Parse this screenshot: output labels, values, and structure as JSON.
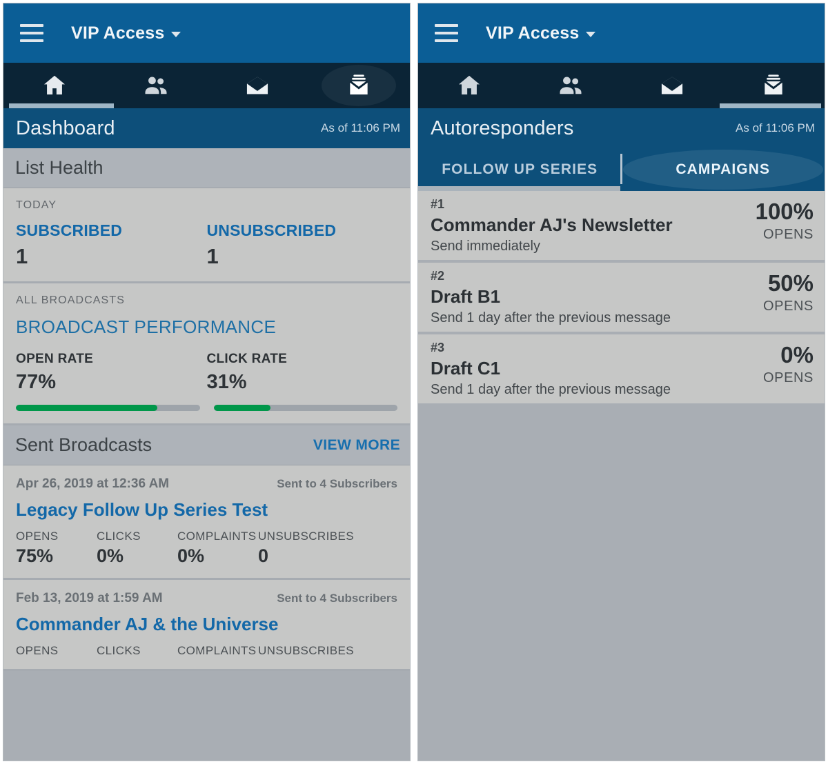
{
  "colors": {
    "appbar": "#0b5e96",
    "navbar": "#0b2436",
    "title_band": "#0d4f7a",
    "accent_blue": "#1368a8",
    "progress_green": "#00974a",
    "panel_gray": "#c6c7c6",
    "page_gray": "#a9aeb4"
  },
  "left_panel": {
    "appbar": {
      "menu_icon": "hamburger-icon",
      "brand": "VIP Access",
      "dropdown_icon": "caret-down-icon"
    },
    "nav": {
      "items": [
        {
          "icon": "home-icon",
          "name": "home"
        },
        {
          "icon": "people-icon",
          "name": "subscribers"
        },
        {
          "icon": "mail-open-icon",
          "name": "broadcasts"
        },
        {
          "icon": "drafts-stack-icon",
          "name": "autoresponders"
        }
      ],
      "active_index": 0
    },
    "title": "Dashboard",
    "as_of": "As of 11:06 PM",
    "list_health": {
      "section_title": "List Health",
      "kicker": "TODAY",
      "stats": [
        {
          "label": "SUBSCRIBED",
          "value": "1"
        },
        {
          "label": "UNSUBSCRIBED",
          "value": "1"
        }
      ]
    },
    "broadcast_performance": {
      "kicker": "ALL BROADCASTS",
      "heading": "BROADCAST PERFORMANCE",
      "stats": [
        {
          "label": "OPEN RATE",
          "value": "77%",
          "percent": 77
        },
        {
          "label": "CLICK RATE",
          "value": "31%",
          "percent": 31
        }
      ]
    },
    "sent_broadcasts": {
      "section_title": "Sent Broadcasts",
      "view_more": "VIEW MORE",
      "items": [
        {
          "date": "Apr 26, 2019 at 12:36 AM",
          "sent_to": "Sent to 4 Subscribers",
          "title": "Legacy Follow Up Series Test",
          "stats": [
            {
              "label": "OPENS",
              "value": "75%"
            },
            {
              "label": "CLICKS",
              "value": "0%"
            },
            {
              "label": "COMPLAINTS",
              "value": "0%"
            },
            {
              "label": "UNSUBSCRIBES",
              "value": "0"
            }
          ]
        },
        {
          "date": "Feb 13, 2019 at 1:59 AM",
          "sent_to": "Sent to 4 Subscribers",
          "title": "Commander AJ & the Universe",
          "stats": [
            {
              "label": "OPENS",
              "value": ""
            },
            {
              "label": "CLICKS",
              "value": ""
            },
            {
              "label": "COMPLAINTS",
              "value": ""
            },
            {
              "label": "UNSUBSCRIBES",
              "value": ""
            }
          ]
        }
      ]
    }
  },
  "right_panel": {
    "appbar": {
      "menu_icon": "hamburger-icon",
      "brand": "VIP Access",
      "dropdown_icon": "caret-down-icon"
    },
    "nav": {
      "items": [
        {
          "icon": "home-icon",
          "name": "home"
        },
        {
          "icon": "people-icon",
          "name": "subscribers"
        },
        {
          "icon": "mail-open-icon",
          "name": "broadcasts"
        },
        {
          "icon": "drafts-stack-icon",
          "name": "autoresponders"
        }
      ],
      "active_index": 3
    },
    "title": "Autoresponders",
    "as_of": "As of 11:06 PM",
    "tabs": [
      {
        "label": "FOLLOW UP SERIES",
        "active": false
      },
      {
        "label": "CAMPAIGNS",
        "active": true
      }
    ],
    "campaigns": [
      {
        "number": "#1",
        "name": "Commander AJ's Newsletter",
        "schedule": "Send immediately",
        "percent": "100%",
        "metric": "OPENS"
      },
      {
        "number": "#2",
        "name": "Draft B1",
        "schedule": "Send 1 day after the previous message",
        "percent": "50%",
        "metric": "OPENS"
      },
      {
        "number": "#3",
        "name": "Draft C1",
        "schedule": "Send 1 day after the previous message",
        "percent": "0%",
        "metric": "OPENS"
      }
    ]
  }
}
